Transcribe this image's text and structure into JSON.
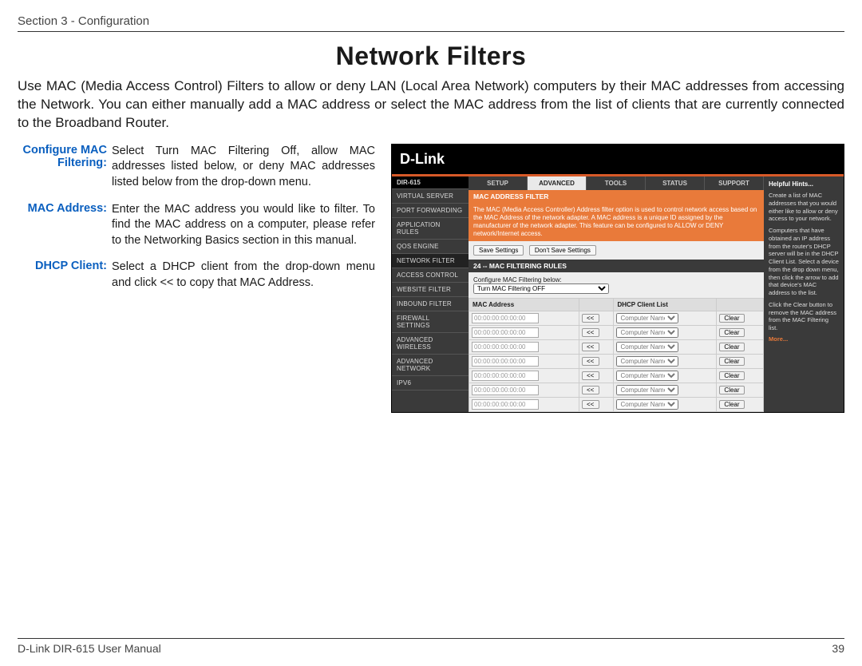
{
  "header": {
    "section": "Section 3 - Configuration"
  },
  "title": "Network Filters",
  "intro": "Use MAC (Media Access Control) Filters to allow or deny LAN (Local Area Network) computers by their MAC addresses from accessing the Network. You can either manually add a MAC address or select the MAC address from the list of clients that are currently connected to the Broadband Router.",
  "defs": [
    {
      "term": "Configure MAC Filtering:",
      "text": "Select Turn MAC Filtering Off, allow MAC addresses listed below, or deny MAC addresses listed below from the drop-down menu."
    },
    {
      "term": "MAC Address:",
      "text": "Enter the MAC address you would like to filter. To find the MAC address on a computer, please refer to the Networking Basics section in this manual."
    },
    {
      "term": "DHCP Client:",
      "text": "Select a DHCP client from the drop-down menu and click << to copy that MAC Address."
    }
  ],
  "shot": {
    "brand": "D-Link",
    "model": "DIR-615",
    "tabs": [
      "SETUP",
      "ADVANCED",
      "TOOLS",
      "STATUS",
      "SUPPORT"
    ],
    "active_tab": 1,
    "side": [
      "VIRTUAL SERVER",
      "PORT FORWARDING",
      "APPLICATION RULES",
      "QOS ENGINE",
      "NETWORK FILTER",
      "ACCESS CONTROL",
      "WEBSITE FILTER",
      "INBOUND FILTER",
      "FIREWALL SETTINGS",
      "ADVANCED WIRELESS",
      "ADVANCED NETWORK",
      "IPv6"
    ],
    "panel_title": "MAC ADDRESS FILTER",
    "panel_text": "The MAC (Media Access Controller) Address filter option is used to control network access based on the MAC Address of the network adapter. A MAC address is a unique ID assigned by the manufacturer of the network adapter. This feature can be configured to ALLOW or DENY network/Internet access.",
    "save": "Save Settings",
    "dontsave": "Don't Save Settings",
    "rules_title": "24 -- MAC FILTERING RULES",
    "cfg_label": "Configure MAC Filtering below:",
    "cfg_sel": "Turn MAC Filtering OFF",
    "th": {
      "mac": "MAC Address",
      "dhcp": "DHCP Client List"
    },
    "row": {
      "mac": "00:00:00:00:00:00",
      "arrow": "<<",
      "dhcp": "Computer Name",
      "clear": "Clear"
    },
    "rows": 7,
    "help": {
      "title": "Helpful Hints...",
      "p1": "Create a list of MAC addresses that you would either like to allow or deny access to your network.",
      "p2": "Computers that have obtained an IP address from the router's DHCP server will be in the DHCP Client List. Select a device from the drop down menu, then click the arrow to add that device's MAC address to the list.",
      "p3": "Click the Clear button to remove the MAC address from the MAC Filtering list.",
      "more": "More..."
    }
  },
  "footer": {
    "left": "D-Link DIR-615 User Manual",
    "right": "39"
  }
}
